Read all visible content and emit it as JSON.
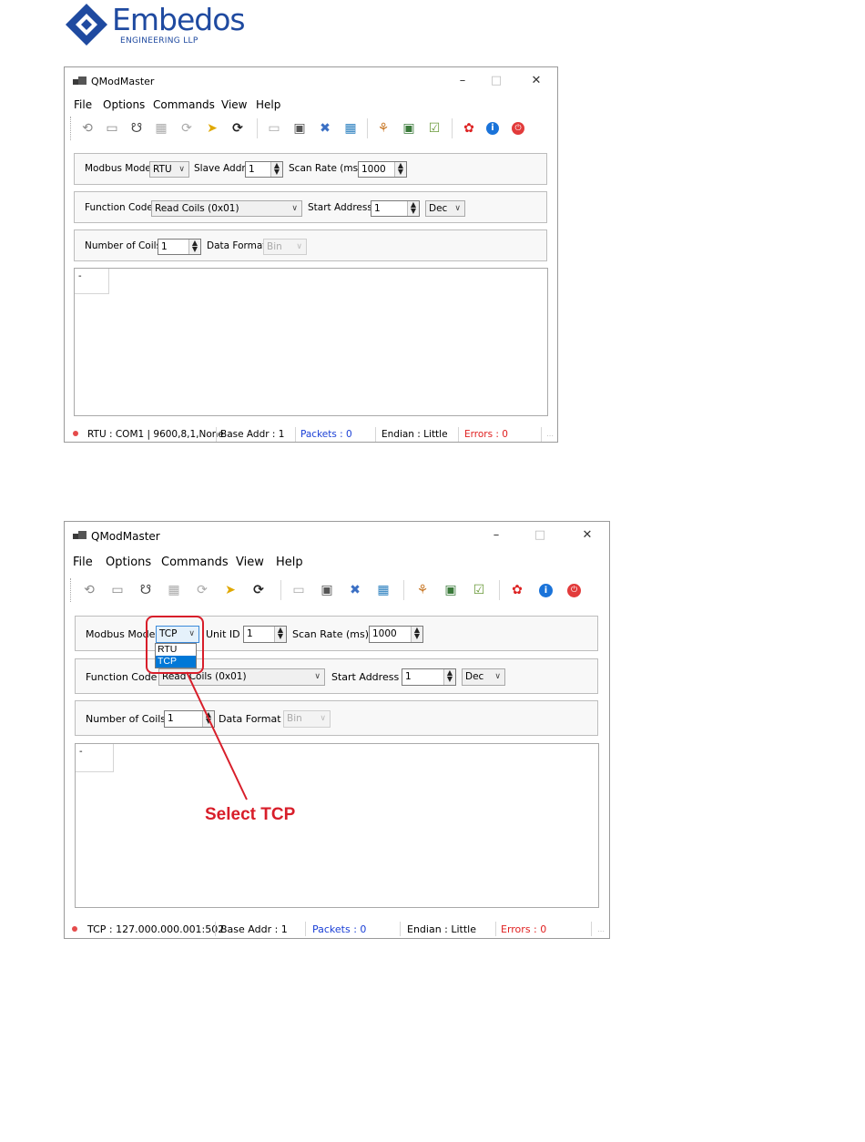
{
  "logo": {
    "brand": "Embedos",
    "tagline": "ENGINEERING LLP",
    "color": "#1f4aa0"
  },
  "window_top": {
    "title": "QModMaster",
    "menu": [
      "File",
      "Options",
      "Commands",
      "View",
      "Help"
    ],
    "modbus_mode_label": "Modbus Mode",
    "modbus_mode_value": "RTU",
    "addr_label": "Slave Addr",
    "addr_value": "1",
    "scan_label": "Scan Rate (ms)",
    "scan_value": "1000",
    "function_label": "Function Code",
    "function_value": "Read Coils (0x01)",
    "start_label": "Start Address",
    "start_value": "1",
    "base_value": "Dec",
    "count_label": "Number of Coils",
    "count_value": "1",
    "format_label": "Data Format",
    "format_value": "Bin",
    "cell_value": "-",
    "status": {
      "connection": "RTU : COM1 | 9600,8,1,None",
      "base_addr": "Base Addr : 1",
      "packets": "Packets : 0",
      "endian": "Endian : Little",
      "errors": "Errors : 0"
    }
  },
  "window_bottom": {
    "title": "QModMaster",
    "menu": [
      "File",
      "Options",
      "Commands",
      "View",
      "Help"
    ],
    "modbus_mode_label": "Modbus Mode",
    "modbus_mode_value": "TCP",
    "mode_options": [
      "RTU",
      "TCP"
    ],
    "mode_selected_option": "TCP",
    "addr_label": "Unit ID",
    "addr_value": "1",
    "scan_label": "Scan Rate (ms)",
    "scan_value": "1000",
    "function_label": "Function Code",
    "function_value": "Read Coils (0x01)",
    "start_label": "Start Address",
    "start_value": "1",
    "base_value": "Dec",
    "count_label": "Number of Coils",
    "count_value": "1",
    "format_label": "Data Format",
    "format_value": "Bin",
    "cell_value": "-",
    "status": {
      "connection": "TCP : 127.000.000.001:502",
      "base_addr": "Base Addr : 1",
      "packets": "Packets : 0",
      "endian": "Endian : Little",
      "errors": "Errors : 0"
    }
  },
  "annotation": {
    "callout": "Select TCP",
    "color": "#d81e2a"
  },
  "toolbar_icons": [
    "load-session-icon",
    "save-session-icon",
    "connect-icon",
    "read-write-icon",
    "scan-icon",
    "clear-icon",
    "reset-counters-icon",
    "log-icon",
    "bus-monitor-icon",
    "tools-icon",
    "settings-icon",
    "modbus-rtu-icon",
    "modbus-tcp-icon",
    "headers-icon",
    "help-icon",
    "about-icon",
    "exit-icon"
  ],
  "colors": {
    "packets": "#1a3fd6",
    "errors": "#e02020",
    "selection": "#0078d7",
    "status_led": "#e54b4b"
  }
}
